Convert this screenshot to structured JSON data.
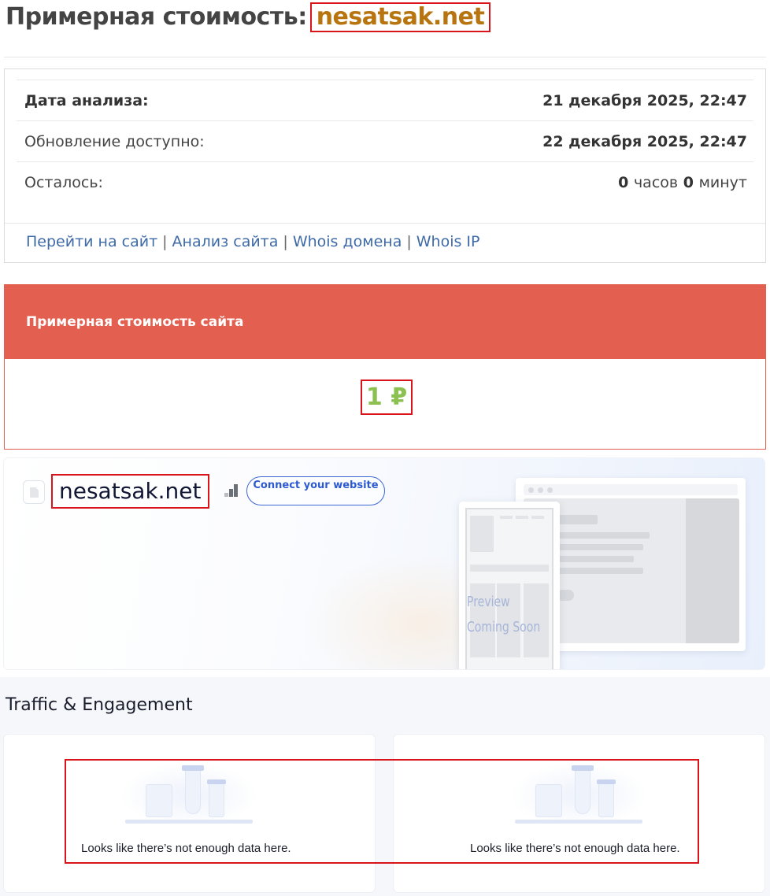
{
  "header": {
    "title_prefix": "Примерная стоимость:",
    "domain": "nesatsak.net"
  },
  "info": {
    "rows": [
      {
        "label": "Дата анализа:",
        "value": "21 декабря 2025, 22:47"
      },
      {
        "label": "Обновление доступно:",
        "value": "22 декабря 2025, 22:47"
      },
      {
        "label": "Осталось:",
        "hours": "0",
        "hours_unit": "часов",
        "minutes": "0",
        "minutes_unit": "минут"
      }
    ],
    "links": [
      "Перейти на сайт",
      "Анализ сайта",
      "Whois домена",
      "Whois IP"
    ],
    "separator": "|"
  },
  "cost": {
    "heading": "Примерная стоимость сайта",
    "value": "1 ₽",
    "accent_color": "#e36050",
    "value_color": "#8cc152"
  },
  "site_card": {
    "name": "nesatsak.net",
    "connect_button": "Connect your website",
    "preview_line1": "Preview",
    "preview_line2": "Coming Soon"
  },
  "traffic": {
    "title": "Traffic & Engagement",
    "empty_message_1": "Looks like there’s not enough data here.",
    "empty_message_2": "Looks like there’s not enough data here."
  }
}
